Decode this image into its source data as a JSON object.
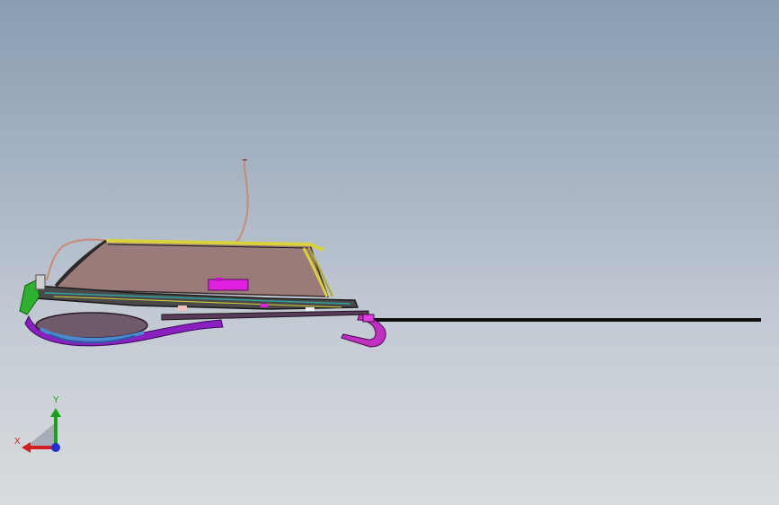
{
  "viewport": {
    "background_top": "#8a9db2",
    "background_bottom": "#d9dcdf"
  },
  "model": {
    "icons": [
      "cad-assembly-side-view"
    ],
    "colors": {
      "glass": "#9b7a7a",
      "frame_yellow": "#d9d23a",
      "trim_magenta": "#e020e0",
      "rail_purple": "#8a20c0",
      "cable": "#c98a7a",
      "lower_tray": "#6e5a6a",
      "blue_parts": "#4a8ad0",
      "green_bracket": "#30b030",
      "rod": "#101010"
    }
  },
  "triad": {
    "x_label": "X",
    "y_label": "Y",
    "colors": {
      "x": "#d42020",
      "y": "#1aa01a",
      "z": "#2030d0"
    }
  }
}
